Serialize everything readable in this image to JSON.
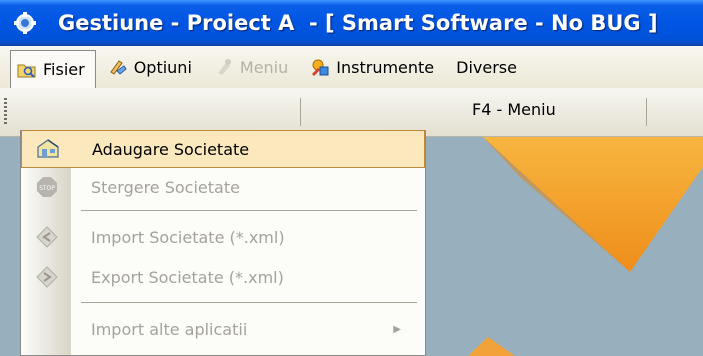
{
  "window": {
    "title": "Gestiune - Proiect A  - [ Smart Software - No BUG ]"
  },
  "menubar": {
    "items": [
      {
        "label": "Fisier",
        "icon": "folder-icon",
        "state": "active"
      },
      {
        "label": "Optiuni",
        "icon": "options-icon",
        "state": "normal"
      },
      {
        "label": "Meniu",
        "icon": "menu-icon",
        "state": "disabled"
      },
      {
        "label": "Instrumente",
        "icon": "tools-icon",
        "state": "normal"
      },
      {
        "label": "Diverse",
        "icon": "",
        "state": "normal"
      }
    ]
  },
  "toolbar": {
    "button_label": "F4 - Meniu"
  },
  "dropdown": {
    "items": [
      {
        "label": "Adaugare Societate",
        "icon": "add-company-icon",
        "highlighted": true
      },
      {
        "label": "Stergere Societate",
        "icon": "stop-icon",
        "disabled": true
      },
      {
        "label": "Import Societate (*.xml)",
        "icon": "import-icon",
        "disabled": true
      },
      {
        "label": "Export Societate (*.xml)",
        "icon": "export-icon",
        "disabled": true
      },
      {
        "label": "Import alte aplicatii",
        "icon": "",
        "disabled": true,
        "submenu": true
      }
    ]
  },
  "colors": {
    "titlebar": "#0054e3",
    "highlight": "#fbe8bc",
    "canvas_shape": "#f5a623",
    "canvas_bg": "#98b0bd"
  }
}
